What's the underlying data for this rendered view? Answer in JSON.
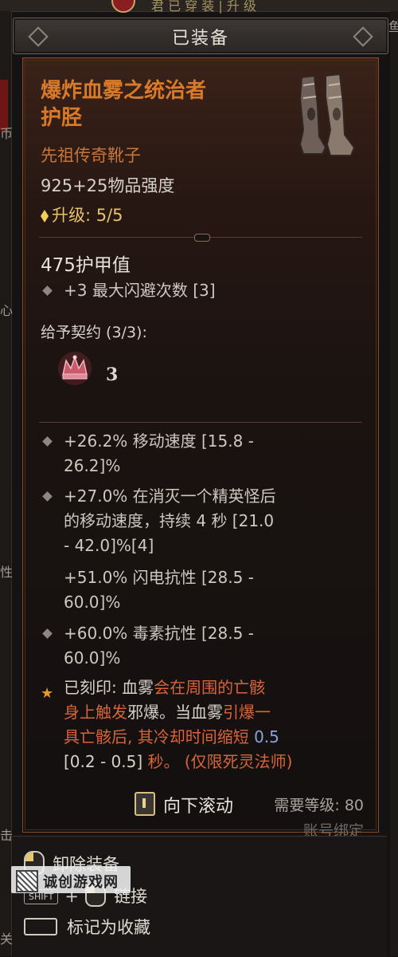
{
  "header": {
    "title": "已装备"
  },
  "item": {
    "name_line1": "爆炸血雾之统治者",
    "name_line2": "护胫",
    "type": "先祖传奇靴子",
    "power": "925+25物品强度",
    "upgrade": "升级: 5/5",
    "armor": "475护甲值",
    "implicit": "+3 最大闪避次数 [3]",
    "contract_label": "给予契约 (3/3):",
    "contract_value": "3",
    "affixes": [
      {
        "l1": "+26.2% 移动速度 [15.8 -",
        "l2": "26.2]%"
      },
      {
        "l1": "+27.0% 在消灭一个精英怪后",
        "l2": "的移动速度，持续 4 秒 [21.0",
        "l3": "- 42.0]%[4]"
      },
      {
        "l1": "+51.0% 闪电抗性 [28.5 -",
        "l2": "60.0]%"
      },
      {
        "l1": "+60.0% 毒素抗性 [28.5 -",
        "l2": "60.0]%"
      }
    ],
    "legendary": {
      "p1": "已刻印: 血雾",
      "p2": "会在周围的亡骸",
      "p3": "身上触发",
      "p4": "邪爆。当血雾",
      "p5": "引爆一",
      "p6": "具亡骸后, 其冷却时间缩短",
      "p7": "0.5",
      "p8": "[0.2 - 0.5]",
      "p9": "秒。",
      "p10": "(仅限死灵法师)"
    },
    "scroll_hint": "向下滚动",
    "required_level": "需要等级: 80",
    "account_bound": "账号绑定"
  },
  "footer": {
    "unequip": "卸除装备",
    "link": "链接",
    "link_key": "SHIFT",
    "favorite": "标记为收藏"
  },
  "watermark": "诚创游戏网",
  "top_strip": "君 已 穿 装 | 升 级",
  "left_strip": [
    "币",
    "心",
    "性",
    "击",
    "关"
  ],
  "right_strip": "鱼",
  "colors": {
    "legendary_orange": "#d97a2b",
    "upgrade_gold": "#e5c26b",
    "affix_orange": "#d7643a",
    "value_blue": "#8aa2dc"
  }
}
